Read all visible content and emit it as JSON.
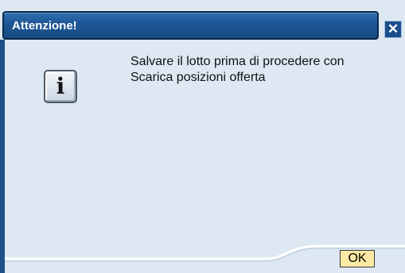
{
  "dialog": {
    "title": "Attenzione!",
    "close_glyph": "✕",
    "icon": "info-icon",
    "icon_glyph": "i",
    "message_lines": [
      "Salvare il lotto prima di procedere con",
      "Scarica posizioni offerta"
    ],
    "ok_label": "OK"
  },
  "colors": {
    "titlebar": "#1f5897",
    "background": "#dde8f2",
    "ok_button": "#fbe9a4"
  }
}
